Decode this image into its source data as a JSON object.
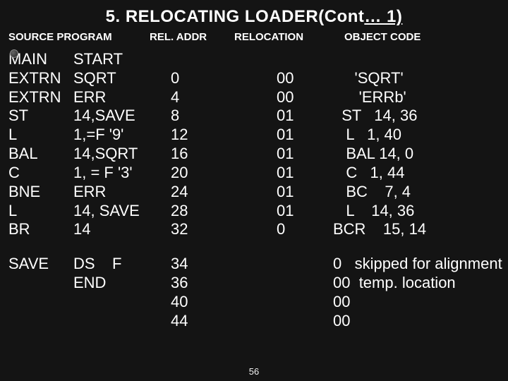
{
  "title_plain": "5. RELOCATING LOADER(Cont",
  "title_under": "… 1)",
  "headers": {
    "source": "SOURCE PROGRAM",
    "rel": "REL. ADDR",
    "reloc": "RELOCATION",
    "obj": "OBJECT CODE"
  },
  "rows": [
    {
      "label": "MAIN",
      "op": "START",
      "addr": "",
      "reloc": "",
      "obj": ""
    },
    {
      "label": "EXTRN",
      "op": "SQRT",
      "addr": "0",
      "reloc": "00",
      "obj": "     'SQRT'"
    },
    {
      "label": "EXTRN",
      "op": "ERR",
      "addr": "4",
      "reloc": "00",
      "obj": "      'ERRb'"
    },
    {
      "label": "ST",
      "op": "14,SAVE",
      "addr": "8",
      "reloc": "01",
      "obj": "  ST   14, 36"
    },
    {
      "label": "L",
      "op": "1,=F '9'",
      "addr": "12",
      "reloc": " 01",
      "obj": "   L   1, 40"
    },
    {
      "label": "BAL",
      "op": "14,SQRT",
      "addr": "16",
      "reloc": " 01",
      "obj": "   BAL 14, 0"
    },
    {
      "label": "C",
      "op": "1, = F '3'",
      "addr": "20",
      "reloc": " 01",
      "obj": "   C   1, 44"
    },
    {
      "label": "BNE",
      "op": "ERR",
      "addr": "24",
      "reloc": " 01",
      "obj": "   BC    7, 4"
    },
    {
      "label": "L",
      "op": "14, SAVE",
      "addr": "28",
      "reloc": "01",
      "obj": "   L    14, 36"
    },
    {
      "label": "BR",
      "op": "14",
      "addr": "32",
      "reloc": " 0",
      "obj": "BCR    15, 14"
    }
  ],
  "rows2": [
    {
      "label": "SAVE",
      "op": "DS    F",
      "addr": "34",
      "reloc": "",
      "obj": "0   skipped for alignment"
    },
    {
      "label": "",
      "op": "END",
      "addr": "36",
      "reloc": "",
      "obj": "00  temp. location"
    },
    {
      "label": "",
      "op": "",
      "addr": "40",
      "reloc": "",
      "obj": "00"
    },
    {
      "label": "",
      "op": "",
      "addr": "44",
      "reloc": "",
      "obj": "00"
    }
  ],
  "pagenum": "56"
}
